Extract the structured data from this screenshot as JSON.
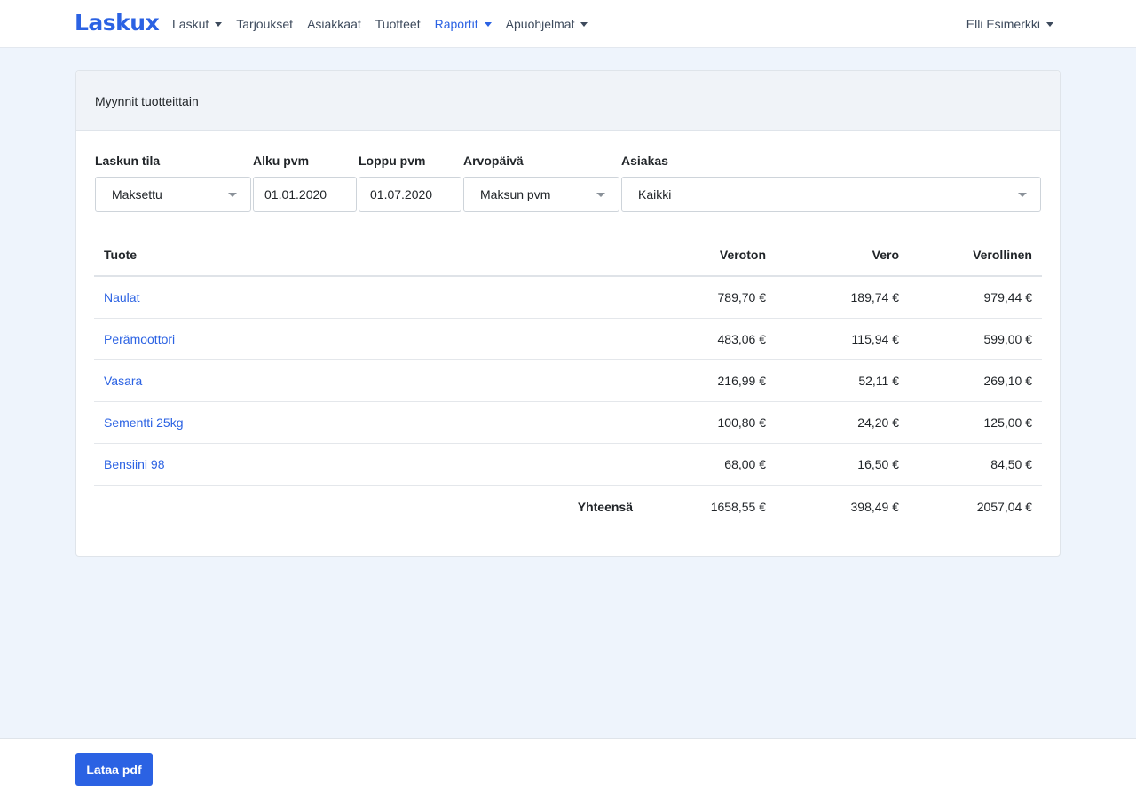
{
  "nav": {
    "brand": "Laskux",
    "items": [
      {
        "label": "Laskut"
      },
      {
        "label": "Tarjoukset"
      },
      {
        "label": "Asiakkaat"
      },
      {
        "label": "Tuotteet"
      },
      {
        "label": "Raportit"
      },
      {
        "label": "Apuohjelmat"
      }
    ],
    "user": "Elli Esimerkki"
  },
  "report": {
    "title": "Myynnit tuotteittain",
    "filters": {
      "status": {
        "label": "Laskun tila",
        "value": "Maksettu"
      },
      "start": {
        "label": "Alku pvm",
        "value": "01.01.2020"
      },
      "end": {
        "label": "Loppu pvm",
        "value": "01.07.2020"
      },
      "value_date": {
        "label": "Arvopäivä",
        "value": "Maksun pvm"
      },
      "customer": {
        "label": "Asiakas",
        "value": "Kaikki"
      }
    },
    "columns": {
      "product": "Tuote",
      "net": "Veroton",
      "vat": "Vero",
      "gross": "Verollinen"
    },
    "rows": [
      {
        "product": "Naulat",
        "net": "789,70 €",
        "vat": "189,74 €",
        "gross": "979,44 €"
      },
      {
        "product": "Perämoottori",
        "net": "483,06 €",
        "vat": "115,94 €",
        "gross": "599,00 €"
      },
      {
        "product": "Vasara",
        "net": "216,99 €",
        "vat": "52,11 €",
        "gross": "269,10 €"
      },
      {
        "product": "Sementti 25kg",
        "net": "100,80 €",
        "vat": "24,20 €",
        "gross": "125,00 €"
      },
      {
        "product": "Bensiini 98",
        "net": "68,00 €",
        "vat": "16,50 €",
        "gross": "84,50 €"
      }
    ],
    "total": {
      "label": "Yhteensä",
      "net": "1658,55 €",
      "vat": "398,49 €",
      "gross": "2057,04 €"
    }
  },
  "footer": {
    "pdf_button": "Lataa pdf"
  },
  "colors": {
    "accent": "#2b62e3",
    "background": "#eef4fc",
    "card_header": "#f0f3f8"
  }
}
